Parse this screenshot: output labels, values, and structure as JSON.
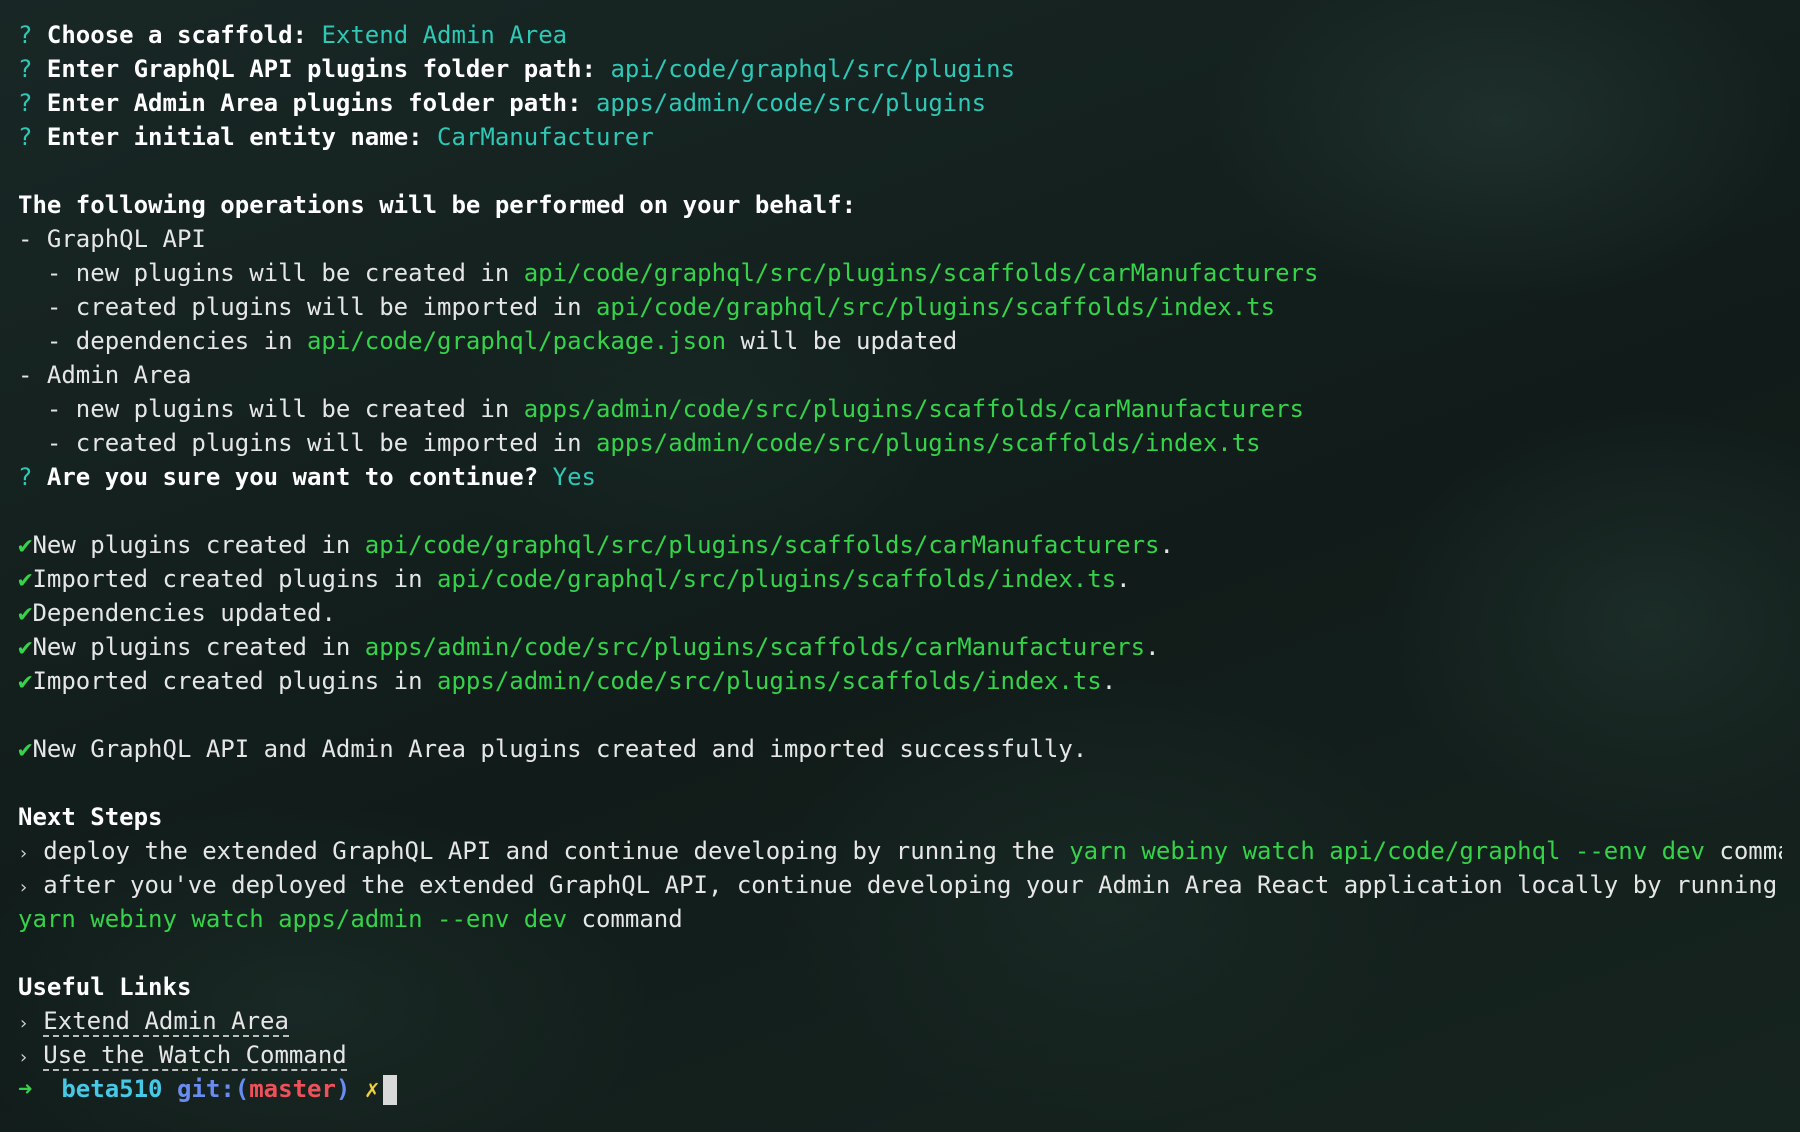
{
  "prompts": [
    {
      "mark": "?",
      "question": "Choose a scaffold:",
      "answer": "Extend Admin Area"
    },
    {
      "mark": "?",
      "question": "Enter GraphQL API plugins folder path:",
      "answer": "api/code/graphql/src/plugins"
    },
    {
      "mark": "?",
      "question": "Enter Admin Area plugins folder path:",
      "answer": "apps/admin/code/src/plugins"
    },
    {
      "mark": "?",
      "question": "Enter initial entity name:",
      "answer": "CarManufacturer"
    }
  ],
  "operations": {
    "heading": "The following operations will be performed on your behalf:",
    "graphql": {
      "title": "- GraphQL API",
      "items": [
        {
          "prefix": "  - new plugins will be created in ",
          "path": "api/code/graphql/src/plugins/scaffolds/carManufacturers",
          "suffix": ""
        },
        {
          "prefix": "  - created plugins will be imported in ",
          "path": "api/code/graphql/src/plugins/scaffolds/index.ts",
          "suffix": ""
        },
        {
          "prefix": "  - dependencies in ",
          "path": "api/code/graphql/package.json",
          "suffix": " will be updated"
        }
      ]
    },
    "admin": {
      "title": "- Admin Area",
      "items": [
        {
          "prefix": "  - new plugins will be created in ",
          "path": "apps/admin/code/src/plugins/scaffolds/carManufacturers",
          "suffix": ""
        },
        {
          "prefix": "  - created plugins will be imported in ",
          "path": "apps/admin/code/src/plugins/scaffolds/index.ts",
          "suffix": ""
        }
      ]
    },
    "confirm": {
      "mark": "?",
      "question": "Are you sure you want to continue?",
      "answer": "Yes"
    }
  },
  "results": [
    {
      "check": "✔",
      "text": "New plugins created in ",
      "path": "api/code/graphql/src/plugins/scaffolds/carManufacturers",
      "suffix": "."
    },
    {
      "check": "✔",
      "text": "Imported created plugins in ",
      "path": "api/code/graphql/src/plugins/scaffolds/index.ts",
      "suffix": "."
    },
    {
      "check": "✔",
      "text": "Dependencies updated.",
      "path": "",
      "suffix": ""
    },
    {
      "check": "✔",
      "text": "New plugins created in ",
      "path": "apps/admin/code/src/plugins/scaffolds/carManufacturers",
      "suffix": "."
    },
    {
      "check": "✔",
      "text": "Imported created plugins in ",
      "path": "apps/admin/code/src/plugins/scaffolds/index.ts",
      "suffix": "."
    }
  ],
  "success": {
    "check": "✔",
    "text": "New GraphQL API and Admin Area plugins created and imported successfully."
  },
  "next_steps": {
    "heading": "Next Steps",
    "bullet": "›",
    "step1": {
      "prefix": " deploy the extended GraphQL API and continue developing by running the ",
      "command": "yarn webiny watch api/code/graphql --env dev",
      "suffix": " command"
    },
    "step2": {
      "prefix": " after you've deployed the extended GraphQL API, continue developing your Admin Area React application locally by running the",
      "command": "yarn webiny watch apps/admin --env dev",
      "suffix": " command"
    }
  },
  "useful_links": {
    "heading": "Useful Links",
    "bullet": "›",
    "links": [
      "Extend Admin Area",
      "Use the Watch Command"
    ]
  },
  "shell_prompt": {
    "arrow": "➜",
    "host": "beta510",
    "git_label": "git:(",
    "branch": "master",
    "git_close": ")",
    "dirty": "✗"
  }
}
